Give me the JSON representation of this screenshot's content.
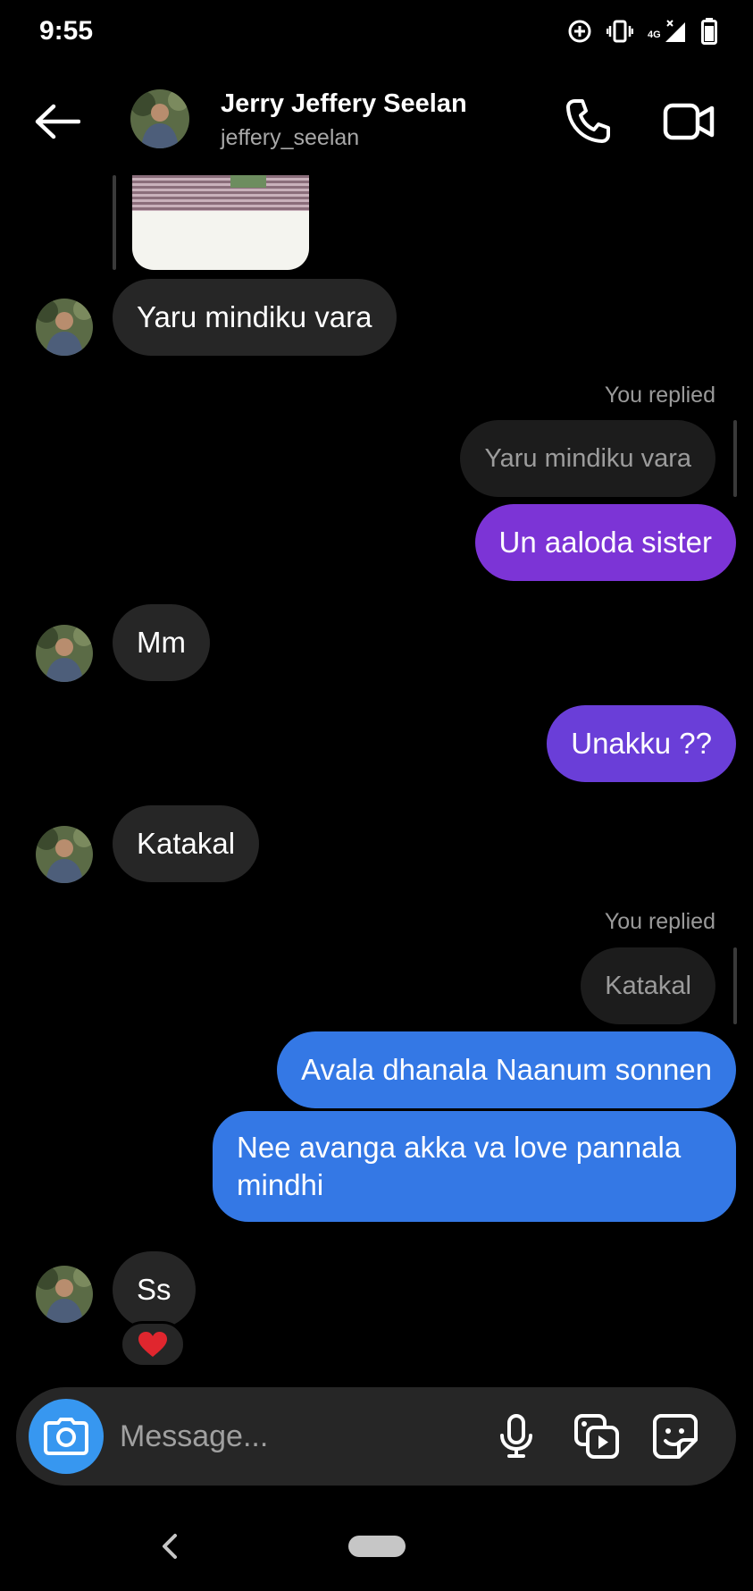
{
  "status_bar": {
    "time": "9:55",
    "network_label": "4G"
  },
  "header": {
    "name": "Jerry Jeffery Seelan",
    "handle": "jeffery_seelan"
  },
  "messages": [
    {
      "side": "in",
      "text": "Yaru mindiku vara"
    },
    {
      "side": "out",
      "replied_label": "You replied",
      "quoted": "Yaru mindiku vara",
      "text": "Un aaloda sister"
    },
    {
      "side": "in",
      "text": "Mm"
    },
    {
      "side": "out",
      "text": "Unakku ??"
    },
    {
      "side": "in",
      "text": "Katakal"
    },
    {
      "side": "out",
      "replied_label": "You replied",
      "quoted": "Katakal",
      "text": "Avala dhanala Naanum sonnen"
    },
    {
      "side": "out",
      "text": "Nee avanga akka va love pannala mindhi"
    },
    {
      "side": "in",
      "text": "Ss",
      "reaction": "❤️"
    }
  ],
  "composer": {
    "placeholder": "Message..."
  },
  "colors": {
    "incoming_bubble": "#262626",
    "outgoing_purple": "#7c34d6",
    "outgoing_violet": "#6a3ed8",
    "outgoing_blue": "#3478e5",
    "camera_button": "#3797f0"
  },
  "icons": {
    "back": "arrow-left-icon",
    "call": "phone-icon",
    "video": "video-camera-icon",
    "camera": "camera-icon",
    "mic": "microphone-icon",
    "gallery": "gallery-icon",
    "sticker": "sticker-icon"
  }
}
